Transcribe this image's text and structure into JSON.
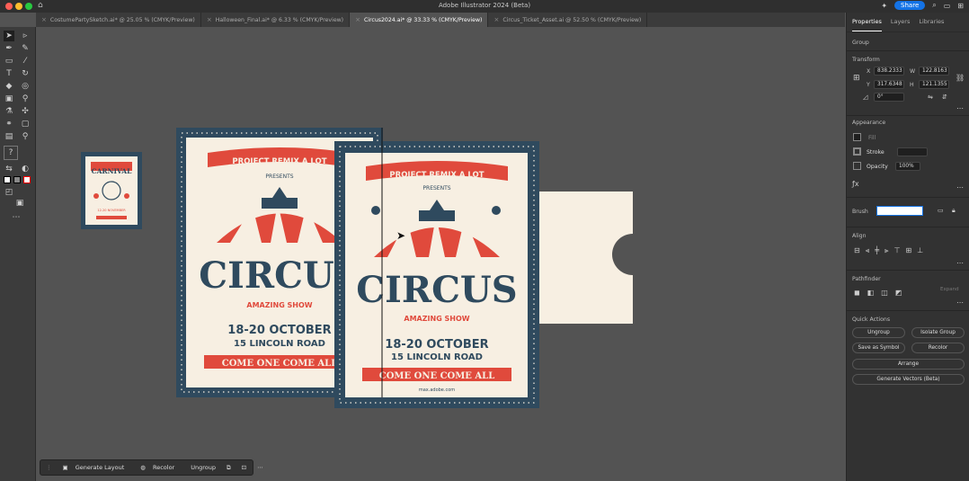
{
  "app": {
    "title": "Adobe Illustrator 2024 (Beta)",
    "share_label": "Share"
  },
  "tabs": [
    {
      "label": "CostumePartySketch.ai* @ 25.05 % (CMYK/Preview)"
    },
    {
      "label": "Halloween_Final.ai* @ 6.33 % (CMYK/Preview)"
    },
    {
      "label": "Circus2024.ai* @ 33.33 % (CMYK/Preview)"
    },
    {
      "label": "Circus_Ticket_Asset.ai @ 52.50 % (CMYK/Preview)"
    }
  ],
  "panel": {
    "tabs": [
      "Properties",
      "Layers",
      "Libraries"
    ],
    "selection": "Group",
    "transform": {
      "label": "Transform",
      "x_label": "X",
      "x": "838.2333",
      "y_label": "Y",
      "y": "317.6348",
      "w_label": "W",
      "w": "122.8163",
      "h_label": "H",
      "h": "121.1355",
      "angle": "0°"
    },
    "appearance": {
      "label": "Appearance",
      "fill": "Fill",
      "stroke": "Stroke",
      "opacity_label": "Opacity",
      "opacity": "100%"
    },
    "brush_label": "Brush",
    "align_label": "Align",
    "pathfinder_label": "Pathfinder",
    "pathfinder_expand": "Expand",
    "quick_actions": {
      "label": "Quick Actions",
      "ungroup": "Ungroup",
      "isolate": "Isolate Group",
      "save_symbol": "Save as Symbol",
      "recolor": "Recolor",
      "arrange": "Arrange",
      "generate": "Generate Vectors (Beta)"
    }
  },
  "context_bar": {
    "generate_layout": "Generate Layout",
    "recolor": "Recolor",
    "ungroup": "Ungroup"
  },
  "poster_small": {
    "title": "CARNIVAL",
    "dates": "12-20 NOVEMBER"
  },
  "poster": {
    "banner": "PROJECT REMIX A LOT",
    "presents": "PRESENTS",
    "title": "CIRCUS",
    "subtitle": "AMAZING SHOW",
    "dates": "18-20 OCTOBER",
    "address": "15 LINCOLN ROAD",
    "cta": "COME ONE   COME ALL",
    "cta_left": "COME ONE   COME ALL",
    "url": "max.adobe.com"
  },
  "colors": {
    "navy": "#2f4a5e",
    "red": "#e04a3c",
    "cream": "#f7efe2",
    "accent": "#1473e6"
  }
}
